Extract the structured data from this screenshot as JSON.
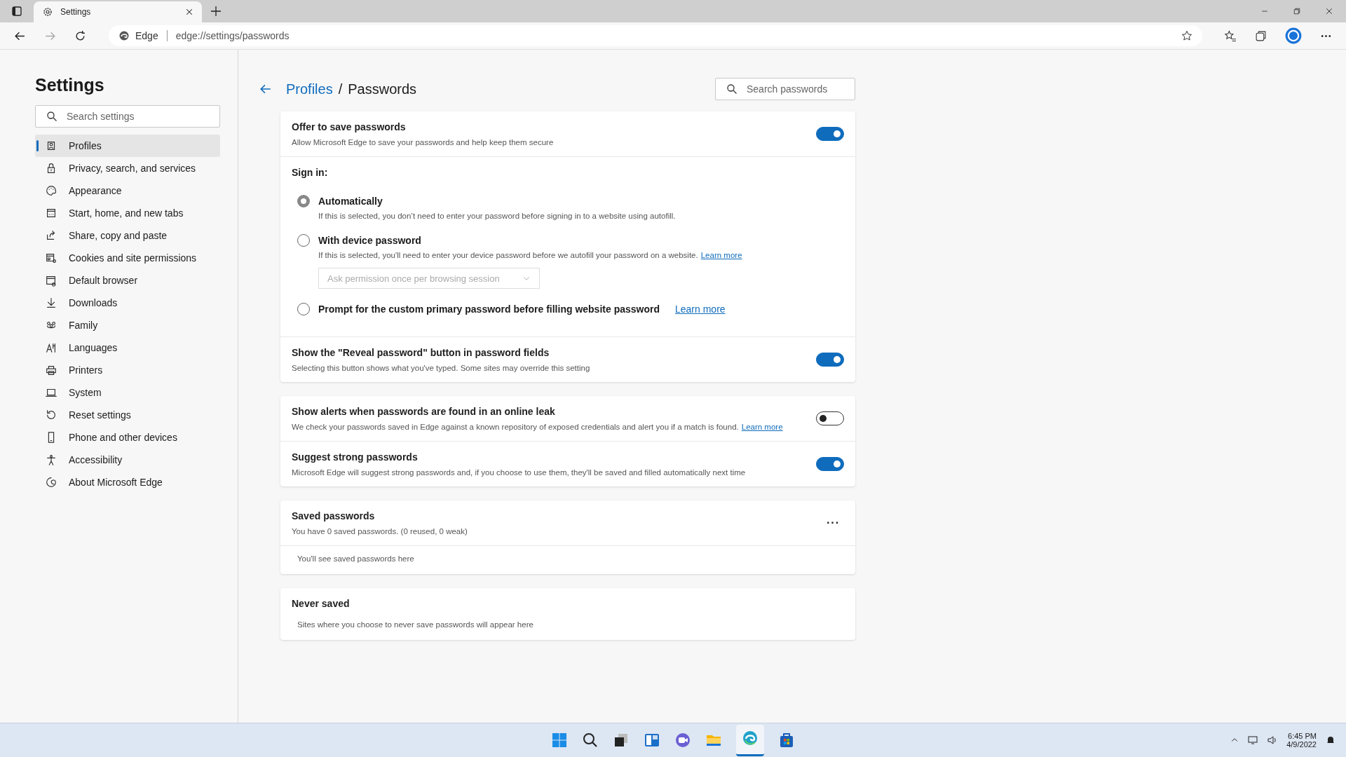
{
  "browser": {
    "tab_title": "Settings",
    "site_label": "Edge",
    "url": "edge://settings/passwords"
  },
  "sidebar": {
    "title": "Settings",
    "search_placeholder": "Search settings",
    "items": [
      {
        "label": "Profiles",
        "selected": true
      },
      {
        "label": "Privacy, search, and services",
        "selected": false
      },
      {
        "label": "Appearance",
        "selected": false
      },
      {
        "label": "Start, home, and new tabs",
        "selected": false
      },
      {
        "label": "Share, copy and paste",
        "selected": false
      },
      {
        "label": "Cookies and site permissions",
        "selected": false
      },
      {
        "label": "Default browser",
        "selected": false
      },
      {
        "label": "Downloads",
        "selected": false
      },
      {
        "label": "Family",
        "selected": false
      },
      {
        "label": "Languages",
        "selected": false
      },
      {
        "label": "Printers",
        "selected": false
      },
      {
        "label": "System",
        "selected": false
      },
      {
        "label": "Reset settings",
        "selected": false
      },
      {
        "label": "Phone and other devices",
        "selected": false
      },
      {
        "label": "Accessibility",
        "selected": false
      },
      {
        "label": "About Microsoft Edge",
        "selected": false
      }
    ]
  },
  "page": {
    "breadcrumb_parent": "Profiles",
    "breadcrumb_separator": "/",
    "breadcrumb_current": "Passwords",
    "search_placeholder": "Search passwords"
  },
  "cards": [
    {
      "kind": "settings",
      "rows": [
        {
          "kind": "toggle",
          "title": "Offer to save passwords",
          "description": "Allow Microsoft Edge to save your passwords and help keep them secure",
          "on": true
        },
        {
          "kind": "signin",
          "label": "Sign in:",
          "options": [
            {
              "label": "Automatically",
              "description": "If this is selected, you don’t need to enter your password before signing in to a website using autofill.",
              "selected": true
            },
            {
              "label": "With device password",
              "description": "If this is selected, you'll need to enter your device password before we autofill your password on a website.",
              "link": "Learn more",
              "selected": false,
              "dropdown": {
                "value": "Ask permission once per browsing session",
                "disabled": true
              }
            },
            {
              "label": "Prompt for the custom primary password before filling website password",
              "link": "Learn more",
              "selected": false
            }
          ]
        },
        {
          "kind": "toggle",
          "title": "Show the \"Reveal password\" button in password fields",
          "description": "Selecting this button shows what you've typed. Some sites may override this setting",
          "on": true
        }
      ]
    },
    {
      "kind": "settings",
      "rows": [
        {
          "kind": "toggle",
          "title": "Show alerts when passwords are found in an online leak",
          "description": "We check your passwords saved in Edge against a known repository of exposed credentials and alert you if a match is found.",
          "link": "Learn more",
          "on": false
        },
        {
          "kind": "toggle",
          "title": "Suggest strong passwords",
          "description": "Microsoft Edge will suggest strong passwords and, if you choose to use them, they'll be saved and filled automatically next time",
          "on": true
        }
      ]
    },
    {
      "kind": "list",
      "title": "Saved passwords",
      "subtitle": "You have 0 saved passwords. (0 reused, 0 weak)",
      "menu": "···",
      "empty": "You'll see saved passwords here"
    },
    {
      "kind": "list",
      "title": "Never saved",
      "empty": "Sites where you choose to never save passwords will appear here"
    }
  ],
  "taskbar": {
    "time": "6:45 PM",
    "date": "4/9/2022"
  }
}
